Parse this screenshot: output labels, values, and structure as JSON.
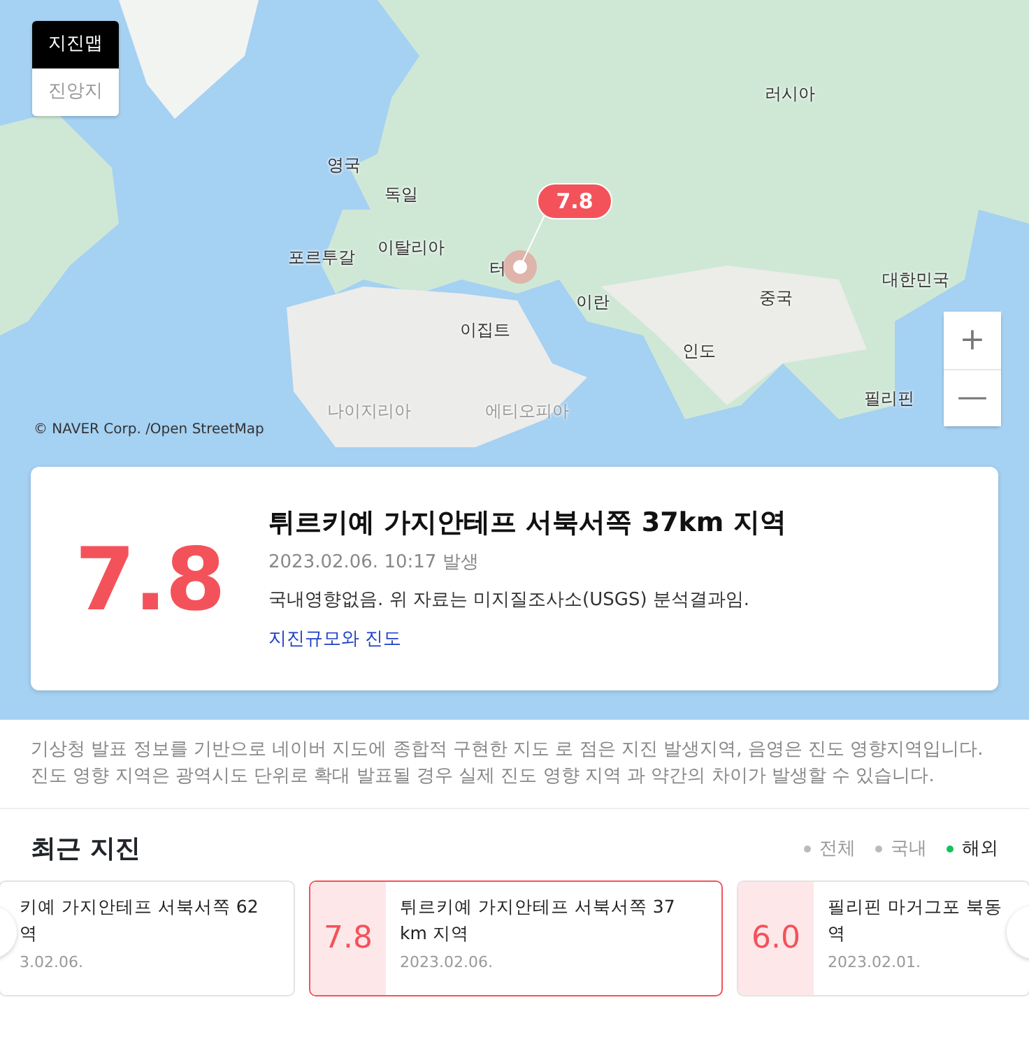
{
  "map": {
    "view_toggle": [
      {
        "label": "지진맵",
        "selected": true
      },
      {
        "label": "진앙지",
        "selected": false
      }
    ],
    "place_labels": [
      {
        "text": "러시아",
        "faded": false
      },
      {
        "text": "영국",
        "faded": false
      },
      {
        "text": "독일",
        "faded": false
      },
      {
        "text": "이탈리아",
        "faded": false
      },
      {
        "text": "포르투갈",
        "faded": false
      },
      {
        "text": "터",
        "faded": false
      },
      {
        "text": "이란",
        "faded": false
      },
      {
        "text": "중국",
        "faded": false
      },
      {
        "text": "대한민국",
        "faded": false
      },
      {
        "text": "이집트",
        "faded": false
      },
      {
        "text": "인도",
        "faded": false
      },
      {
        "text": "필리핀",
        "faded": false
      },
      {
        "text": "나이지리아",
        "faded": true
      },
      {
        "text": "에티오피아",
        "faded": true
      }
    ],
    "marker": {
      "magnitude": "7.8"
    },
    "zoom_buttons": [
      "+",
      "—"
    ],
    "attribution": "© NAVER Corp. /Open StreetMap"
  },
  "detail": {
    "magnitude": "7.8",
    "title": "튀르키예 가지안테프 서북서쪽 37km 지역",
    "time": "2023.02.06. 10:17 발생",
    "note": "국내영향없음. 위 자료는 미지질조사소(USGS) 분석결과임.",
    "link": "지진규모와 진도"
  },
  "notice": "기상청 발표 정보를 기반으로 네이버 지도에 종합적 구현한 지도 로 점은 지진 발생지역, 음영은 진도 영향지역입니다. 진도 영향 지역은 광역시도 단위로 확대 발표될 경우 실제 진도 영향 지역 과 약간의 차이가 발생할 수 있습니다.",
  "recent": {
    "title": "최근 지진",
    "filters": [
      {
        "label": "전체",
        "selected": false
      },
      {
        "label": "국내",
        "selected": false
      },
      {
        "label": "해외",
        "selected": true
      }
    ],
    "items": [
      {
        "title": "키예 가지안테프 서북서쪽 62 역",
        "date": "3.02.06.",
        "selected": false
      },
      {
        "magnitude": "7.8",
        "title": "튀르키예 가지안테프 서북서쪽 37 km 지역",
        "date": "2023.02.06.",
        "selected": true
      },
      {
        "magnitude": "6.0",
        "title": "필리핀 마거그포 북동 역",
        "date": "2023.02.01.",
        "selected": false
      }
    ]
  }
}
